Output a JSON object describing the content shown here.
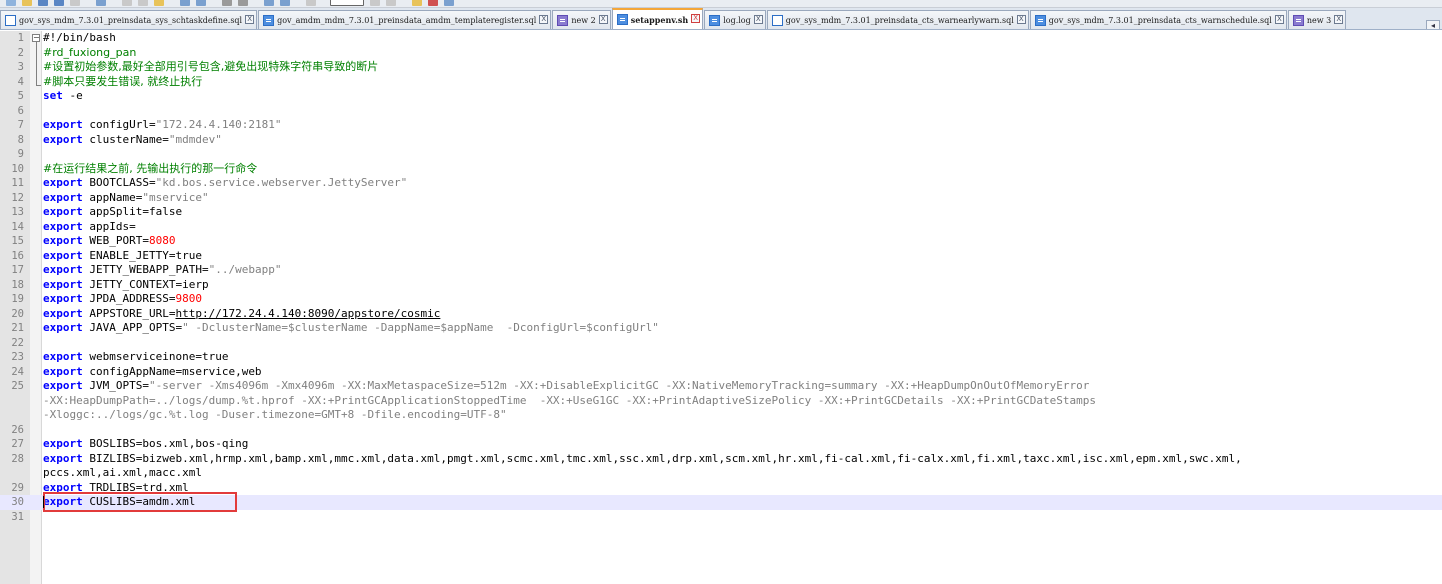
{
  "tabs": [
    {
      "label": "gov_sys_mdm_7.3.01_preinsdata_sys_schtaskdefine.sql",
      "close": "X",
      "icon": "file-icon",
      "color": "white"
    },
    {
      "label": "gov_amdm_mdm_7.3.01_preinsdata_amdm_templateregister.sql",
      "close": "X",
      "icon": "file-icon",
      "color": "blue"
    },
    {
      "label": "new 2",
      "close": "X",
      "icon": "file-icon",
      "color": "purple"
    },
    {
      "label": "setappenv.sh",
      "close": "X",
      "icon": "file-icon",
      "color": "blue",
      "active": true
    },
    {
      "label": "log.log",
      "close": "X",
      "icon": "file-icon",
      "color": "blue"
    },
    {
      "label": "gov_sys_mdm_7.3.01_preinsdata_cts_warnearlywarn.sql",
      "close": "X",
      "icon": "file-icon",
      "color": "white"
    },
    {
      "label": "gov_sys_mdm_7.3.01_preinsdata_cts_warnschedule.sql",
      "close": "X",
      "icon": "file-icon",
      "color": "blue"
    },
    {
      "label": "new 3",
      "close": "X",
      "icon": "file-icon",
      "color": "purple"
    }
  ],
  "tab_scroll": "◂",
  "editor": {
    "fold_open": "−",
    "lines": [
      {
        "n": "1",
        "t": [
          [
            "#!/bin/bash",
            ""
          ]
        ]
      },
      {
        "n": "2",
        "t": [
          [
            "#rd_fuxiong_pan",
            "cmt"
          ]
        ]
      },
      {
        "n": "3",
        "t": [
          [
            "#设置初始参数,最好全部用引号包含,避免出现特殊字符串导致的断片",
            "cmt"
          ]
        ]
      },
      {
        "n": "4",
        "t": [
          [
            "#脚本只要发生错误, 就终止执行",
            "cmt"
          ]
        ]
      },
      {
        "n": "5",
        "t": [
          [
            "set",
            "kw"
          ],
          [
            " -e",
            ""
          ]
        ]
      },
      {
        "n": "6",
        "t": []
      },
      {
        "n": "7",
        "t": [
          [
            "export",
            "kw"
          ],
          [
            " configUrl=",
            ""
          ],
          [
            "\"172.24.4.140:2181\"",
            "str"
          ]
        ]
      },
      {
        "n": "8",
        "t": [
          [
            "export",
            "kw"
          ],
          [
            " clusterName=",
            ""
          ],
          [
            "\"mdmdev\"",
            "str"
          ]
        ]
      },
      {
        "n": "9",
        "t": []
      },
      {
        "n": "10",
        "t": [
          [
            "#在运行结果之前, 先输出执行的那一行命令",
            "cmt"
          ]
        ]
      },
      {
        "n": "11",
        "t": [
          [
            "export",
            "kw"
          ],
          [
            " BOOTCLASS=",
            ""
          ],
          [
            "\"kd.bos.service.webserver.JettyServer\"",
            "str"
          ]
        ]
      },
      {
        "n": "12",
        "t": [
          [
            "export",
            "kw"
          ],
          [
            " appName=",
            ""
          ],
          [
            "\"mservice\"",
            "str"
          ]
        ]
      },
      {
        "n": "13",
        "t": [
          [
            "export",
            "kw"
          ],
          [
            " appSplit=false",
            ""
          ]
        ]
      },
      {
        "n": "14",
        "t": [
          [
            "export",
            "kw"
          ],
          [
            " appIds=",
            ""
          ]
        ]
      },
      {
        "n": "15",
        "t": [
          [
            "export",
            "kw"
          ],
          [
            " WEB_PORT=",
            ""
          ],
          [
            "8080",
            "num"
          ]
        ]
      },
      {
        "n": "16",
        "t": [
          [
            "export",
            "kw"
          ],
          [
            " ENABLE_JETTY=true",
            ""
          ]
        ]
      },
      {
        "n": "17",
        "t": [
          [
            "export",
            "kw"
          ],
          [
            " JETTY_WEBAPP_PATH=",
            ""
          ],
          [
            "\"../webapp\"",
            "str"
          ]
        ]
      },
      {
        "n": "18",
        "t": [
          [
            "export",
            "kw"
          ],
          [
            " JETTY_CONTEXT=ierp",
            ""
          ]
        ]
      },
      {
        "n": "19",
        "t": [
          [
            "export",
            "kw"
          ],
          [
            " JPDA_ADDRESS=",
            ""
          ],
          [
            "9800",
            "num"
          ]
        ]
      },
      {
        "n": "20",
        "t": [
          [
            "export",
            "kw"
          ],
          [
            " APPSTORE_URL=",
            ""
          ],
          [
            "http://172.24.4.140:8090/appstore/cosmic",
            "url"
          ]
        ]
      },
      {
        "n": "21",
        "t": [
          [
            "export",
            "kw"
          ],
          [
            " JAVA_APP_OPTS=",
            ""
          ],
          [
            "\" -DclusterName=$clusterName -DappName=$appName  -DconfigUrl=$configUrl\"",
            "str"
          ]
        ]
      },
      {
        "n": "22",
        "t": []
      },
      {
        "n": "23",
        "t": [
          [
            "export",
            "kw"
          ],
          [
            " webmserviceinone=true",
            ""
          ]
        ]
      },
      {
        "n": "24",
        "t": [
          [
            "export",
            "kw"
          ],
          [
            " configAppName=mservice,web",
            ""
          ]
        ]
      },
      {
        "n": "25",
        "t": [
          [
            "export",
            "kw"
          ],
          [
            " JVM_OPTS=",
            ""
          ],
          [
            "\"-server -Xms4096m -Xmx4096m -XX:MaxMetaspaceSize=512m -XX:+DisableExplicitGC -XX:NativeMemoryTracking=summary -XX:+HeapDumpOnOutOfMemoryError",
            "str"
          ]
        ]
      },
      {
        "n": "",
        "t": [
          [
            "-XX:HeapDumpPath=../logs/dump.%t.hprof -XX:+PrintGCApplicationStoppedTime  -XX:+UseG1GC -XX:+PrintAdaptiveSizePolicy -XX:+PrintGCDetails -XX:+PrintGCDateStamps",
            "str"
          ]
        ]
      },
      {
        "n": "",
        "t": [
          [
            "-Xloggc:../logs/gc.%t.log -Duser.timezone=GMT+8 -Dfile.encoding=UTF-8\"",
            "str"
          ]
        ]
      },
      {
        "n": "26",
        "t": []
      },
      {
        "n": "27",
        "t": [
          [
            "export",
            "kw"
          ],
          [
            " BOSLIBS=bos.xml,bos-qing",
            ""
          ]
        ]
      },
      {
        "n": "28",
        "t": [
          [
            "export",
            "kw"
          ],
          [
            " BIZLIBS=bizweb.xml,hrmp.xml,bamp.xml,mmc.xml,data.xml,pmgt.xml,scmc.xml,tmc.xml,ssc.xml,drp.xml,scm.xml,hr.xml,fi-cal.xml,fi-calx.xml,fi.xml,taxc.xml,isc.xml,epm.xml,swc.xml,",
            ""
          ]
        ]
      },
      {
        "n": "",
        "t": [
          [
            "pccs.xml,ai.xml,macc.xml",
            ""
          ]
        ]
      },
      {
        "n": "29",
        "t": [
          [
            "export",
            "kw"
          ],
          [
            " TRDLIBS=trd.xml",
            ""
          ]
        ]
      },
      {
        "n": "30",
        "t": [
          [
            "export",
            "kw"
          ],
          [
            " CUSLIBS=amdm.xml",
            ""
          ]
        ],
        "current": true
      },
      {
        "n": "31",
        "t": []
      }
    ]
  }
}
